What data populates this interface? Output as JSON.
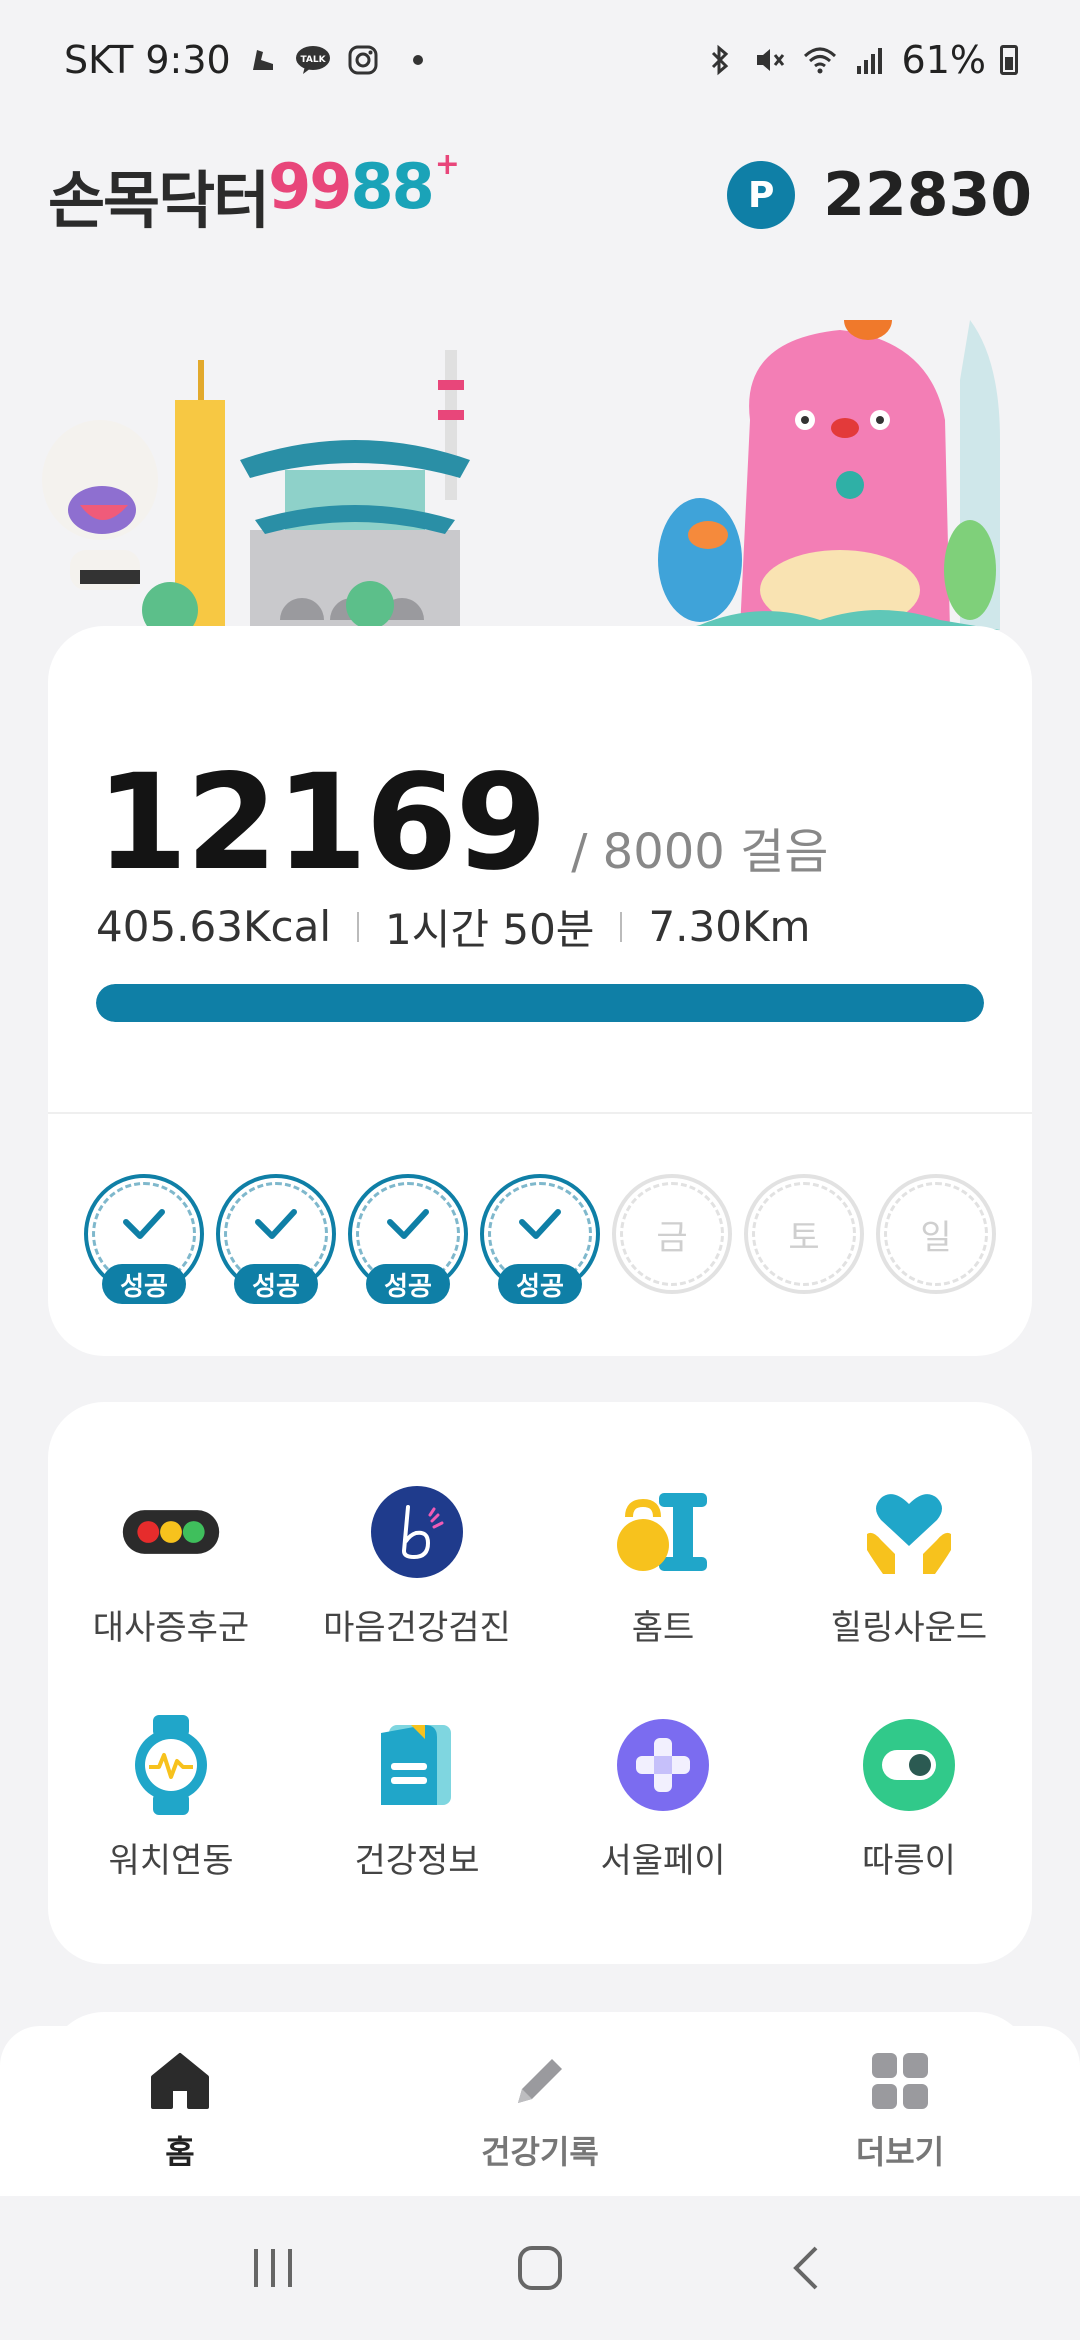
{
  "status_bar": {
    "carrier_time": "SKT 9:30",
    "battery": "61%",
    "left_icons": [
      "shoe-icon",
      "kakaotalk-icon",
      "instagram-icon"
    ],
    "right_icons": [
      "bluetooth-icon",
      "mute-icon",
      "wifi-icon",
      "signal-icon",
      "battery-icon"
    ]
  },
  "header": {
    "logo_korean": "손목닥터",
    "logo_num1": "99",
    "logo_num2": "88",
    "logo_plus": "+",
    "points_badge": "P",
    "points_value": "22830"
  },
  "steps": {
    "count": "12169",
    "goal_text": "/ 8000 걸음",
    "calories": "405.63Kcal",
    "duration": "1시간 50분",
    "distance": "7.30Km",
    "progress_fraction": 1.0,
    "progress_color": "#0f7fa6"
  },
  "week": [
    {
      "label": "",
      "badge": "성공",
      "done": true
    },
    {
      "label": "",
      "badge": "성공",
      "done": true
    },
    {
      "label": "",
      "badge": "성공",
      "done": true
    },
    {
      "label": "",
      "badge": "성공",
      "done": true
    },
    {
      "label": "금",
      "badge": "",
      "done": false
    },
    {
      "label": "토",
      "badge": "",
      "done": false
    },
    {
      "label": "일",
      "badge": "",
      "done": false
    }
  ],
  "menu": [
    {
      "label": "대사증후군",
      "icon": "traffic-light-icon"
    },
    {
      "label": "마음건강검진",
      "icon": "mind-b-icon"
    },
    {
      "label": "홈트",
      "icon": "kettlebell-dumbbell-icon"
    },
    {
      "label": "힐링사운드",
      "icon": "heart-hands-icon"
    },
    {
      "label": "워치연동",
      "icon": "watch-icon"
    },
    {
      "label": "건강정보",
      "icon": "document-icon"
    },
    {
      "label": "서울페이",
      "icon": "plus-coin-icon"
    },
    {
      "label": "따릉이",
      "icon": "bike-toggle-icon"
    }
  ],
  "bottom_nav": {
    "home": "홈",
    "health_record": "건강기록",
    "more": "더보기"
  },
  "colors": {
    "accent": "#0f7fa6",
    "logo_pink": "#e8467a",
    "logo_teal": "#1aa3b8"
  }
}
